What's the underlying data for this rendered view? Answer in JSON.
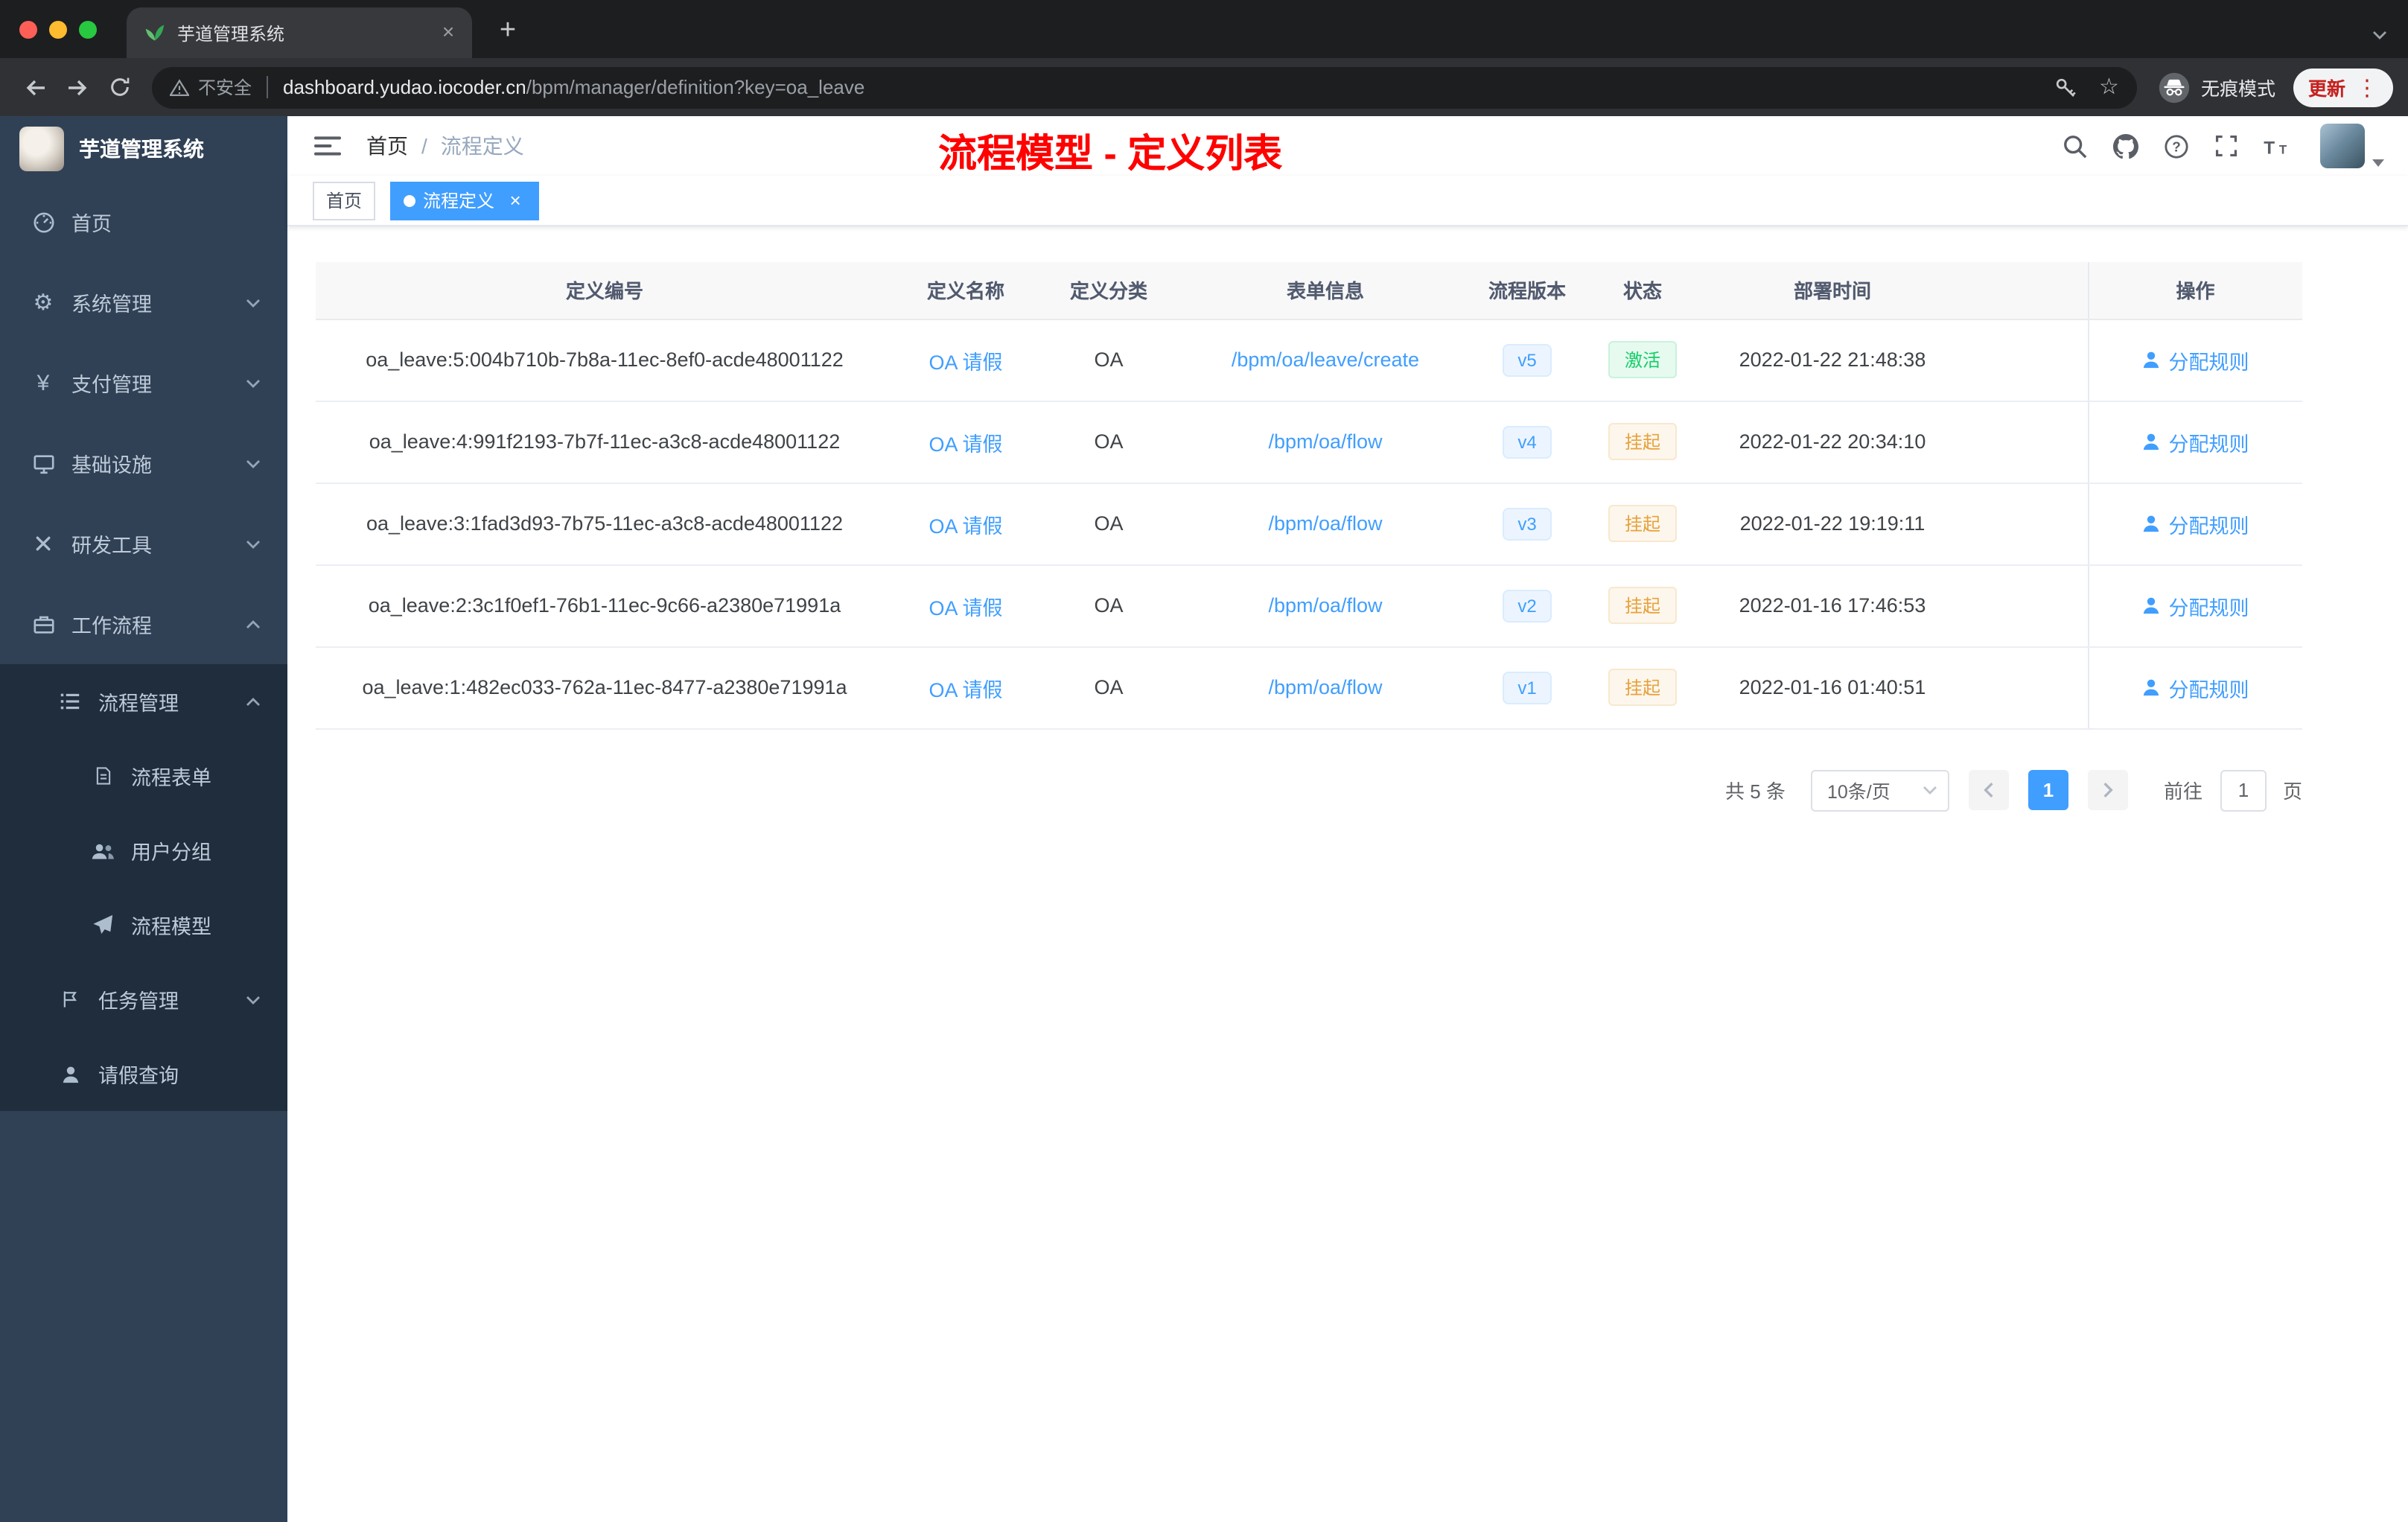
{
  "browser": {
    "tab": {
      "title": "芋道管理系统"
    },
    "address": {
      "security_label": "不安全",
      "url_domain": "dashboard.yudao.iocoder.cn",
      "url_path": "/bpm/manager/definition?key=oa_leave"
    },
    "incognito_label": "无痕模式",
    "update_label": "更新"
  },
  "sidebar": {
    "app_title": "芋道管理系统",
    "items": [
      {
        "label": "首页",
        "icon": "dashboard-icon"
      },
      {
        "label": "系统管理",
        "icon": "gear-icon",
        "arrow": "down"
      },
      {
        "label": "支付管理",
        "icon": "yen-icon",
        "arrow": "down"
      },
      {
        "label": "基础设施",
        "icon": "monitor-icon",
        "arrow": "down"
      },
      {
        "label": "研发工具",
        "icon": "tools-icon",
        "arrow": "down"
      },
      {
        "label": "工作流程",
        "icon": "briefcase-icon",
        "arrow": "up"
      },
      {
        "label": "流程管理",
        "icon": "list-icon",
        "arrow": "up"
      },
      {
        "label": "流程表单",
        "icon": "document-icon"
      },
      {
        "label": "用户分组",
        "icon": "people-icon"
      },
      {
        "label": "流程模型",
        "icon": "send-icon"
      },
      {
        "label": "任务管理",
        "icon": "flag-icon",
        "arrow": "down"
      },
      {
        "label": "请假查询",
        "icon": "person-icon"
      }
    ]
  },
  "header": {
    "breadcrumb": {
      "home": "首页",
      "separator": "/",
      "current": "流程定义"
    },
    "annotation": "流程模型 - 定义列表"
  },
  "tags": {
    "items": [
      {
        "label": "首页",
        "active": false
      },
      {
        "label": "流程定义",
        "active": true
      }
    ]
  },
  "table": {
    "columns": [
      "定义编号",
      "定义名称",
      "定义分类",
      "表单信息",
      "流程版本",
      "状态",
      "部署时间",
      "操作"
    ],
    "rows": [
      {
        "id": "oa_leave:5:004b710b-7b8a-11ec-8ef0-acde48001122",
        "name": "OA 请假",
        "category": "OA",
        "form": "/bpm/oa/leave/create",
        "version": "v5",
        "status": "激活",
        "status_type": "success",
        "time": "2022-01-22 21:48:38",
        "action": "分配规则"
      },
      {
        "id": "oa_leave:4:991f2193-7b7f-11ec-a3c8-acde48001122",
        "name": "OA 请假",
        "category": "OA",
        "form": "/bpm/oa/flow",
        "version": "v4",
        "status": "挂起",
        "status_type": "warning",
        "time": "2022-01-22 20:34:10",
        "action": "分配规则"
      },
      {
        "id": "oa_leave:3:1fad3d93-7b75-11ec-a3c8-acde48001122",
        "name": "OA 请假",
        "category": "OA",
        "form": "/bpm/oa/flow",
        "version": "v3",
        "status": "挂起",
        "status_type": "warning",
        "time": "2022-01-22 19:19:11",
        "action": "分配规则"
      },
      {
        "id": "oa_leave:2:3c1f0ef1-76b1-11ec-9c66-a2380e71991a",
        "name": "OA 请假",
        "category": "OA",
        "form": "/bpm/oa/flow",
        "version": "v2",
        "status": "挂起",
        "status_type": "warning",
        "time": "2022-01-16 17:46:53",
        "action": "分配规则"
      },
      {
        "id": "oa_leave:1:482ec033-762a-11ec-8477-a2380e71991a",
        "name": "OA 请假",
        "category": "OA",
        "form": "/bpm/oa/flow",
        "version": "v1",
        "status": "挂起",
        "status_type": "warning",
        "time": "2022-01-16 01:40:51",
        "action": "分配规则"
      }
    ]
  },
  "pagination": {
    "total": "共 5 条",
    "page_size": "10条/页",
    "current_page": "1",
    "goto_label": "前往",
    "goto_value": "1",
    "page_unit": "页"
  },
  "colors": {
    "accent_blue": "#409eff",
    "success_green": "#13ce66",
    "warning_orange": "#e6a23c",
    "annotation_red": "#fe0100",
    "sidebar_bg": "#304156",
    "submenu_bg": "#1f2d3d"
  }
}
